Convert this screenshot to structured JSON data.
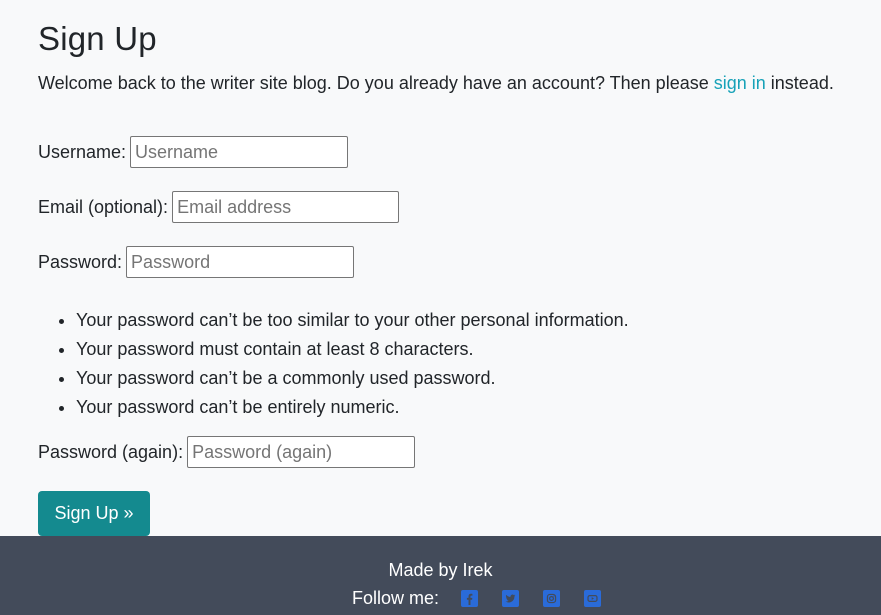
{
  "page": {
    "title": "Sign Up",
    "intro_text": "Welcome back to the writer site blog. Do you already have an account? Then please",
    "intro_link": "sign in",
    "intro_suffix": "instead."
  },
  "form": {
    "username": {
      "label": "Username:",
      "placeholder": "Username"
    },
    "email": {
      "label": "Email (optional):",
      "placeholder": "Email address"
    },
    "password": {
      "label": "Password:",
      "placeholder": "Password"
    },
    "help": [
      "Your password can’t be too similar to your other personal information.",
      "Your password must contain at least 8 characters.",
      "Your password can’t be a commonly used password.",
      "Your password can’t be entirely numeric."
    ],
    "password2": {
      "label": "Password (again):",
      "placeholder": "Password (again)"
    },
    "submit_label": "Sign Up »"
  },
  "footer": {
    "made_by": "Made by Irek",
    "follow_label": "Follow me:",
    "social": [
      {
        "icon": "facebook-icon"
      },
      {
        "icon": "twitter-icon"
      },
      {
        "icon": "instagram-icon"
      },
      {
        "icon": "youtube-icon"
      }
    ],
    "icon_color": "#2a6bd9",
    "background": "#434b5a"
  },
  "colors": {
    "accent": "#17a2b8",
    "button": "#148a8f"
  }
}
